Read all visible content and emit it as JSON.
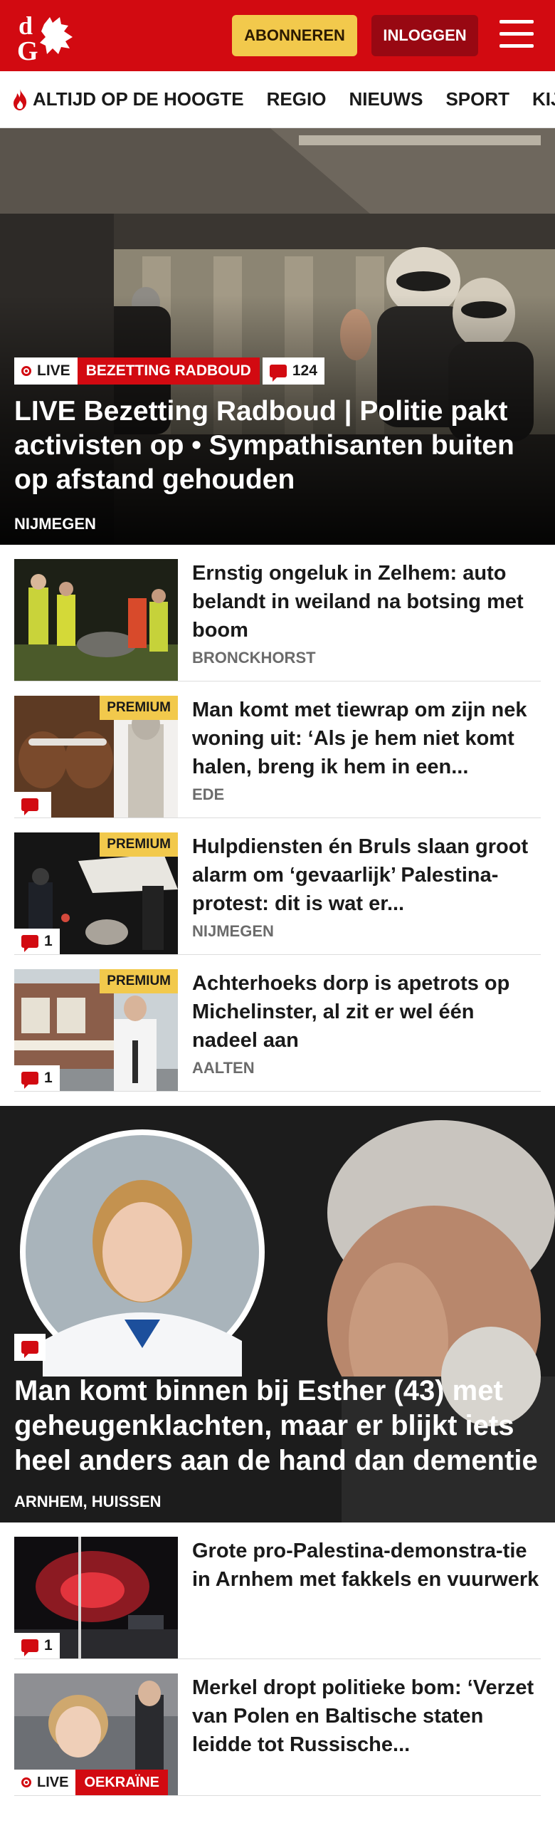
{
  "header": {
    "logo_text": "dG",
    "subscribe_label": "ABONNEREN",
    "login_label": "INLOGGEN",
    "brand_color": "#d20a11"
  },
  "nav": {
    "items": [
      "ALTIJD OP DE HOOGTE",
      "REGIO",
      "NIEUWS",
      "SPORT",
      "KIJK"
    ]
  },
  "hero": {
    "live_label": "LIVE",
    "topic": "BEZETTING RADBOUD",
    "comments": "124",
    "title": "LIVE Bezetting Radboud | Politie pakt activisten op • Sympathisanten buiten op afstand gehouden",
    "location": "NIJMEGEN"
  },
  "list1": [
    {
      "title": "Ernstig ongeluk in Zelhem: auto belandt in weiland na botsing met boom",
      "location": "BRONCKHORST",
      "premium": "",
      "comments": ""
    },
    {
      "title": "Man komt met tiewrap om zijn nek woning uit: ‘Als je hem niet komt halen, breng ik hem in een...",
      "location": "EDE",
      "premium": "PREMIUM",
      "comments": ""
    },
    {
      "title": "Hulpdiensten én Bruls slaan groot alarm om ‘gevaarlijk’ Palestina-protest: dit is wat er...",
      "location": "NIJMEGEN",
      "premium": "PREMIUM",
      "comments": "1"
    },
    {
      "title": "Achterhoeks dorp is apetrots op Michelinster, al zit er wel één nadeel aan",
      "location": "AALTEN",
      "premium": "PREMIUM",
      "comments": "1"
    }
  ],
  "feature": {
    "title": "Man komt binnen bij Esther (43) met geheugenklachten, maar er blijkt iets heel anders aan de hand dan dementie",
    "location": "ARNHEM, HUISSEN"
  },
  "list2": [
    {
      "title": "Grote pro-Palestina-demonstra-tie in Arnhem met fakkels en vuurwerk",
      "location": "",
      "comments": "1"
    },
    {
      "title": "Merkel dropt politieke bom: ‘Verzet van Polen en Baltische staten leidde tot Russische...",
      "location": "",
      "live_label": "LIVE",
      "topic": "OEKRAÏNE"
    }
  ]
}
